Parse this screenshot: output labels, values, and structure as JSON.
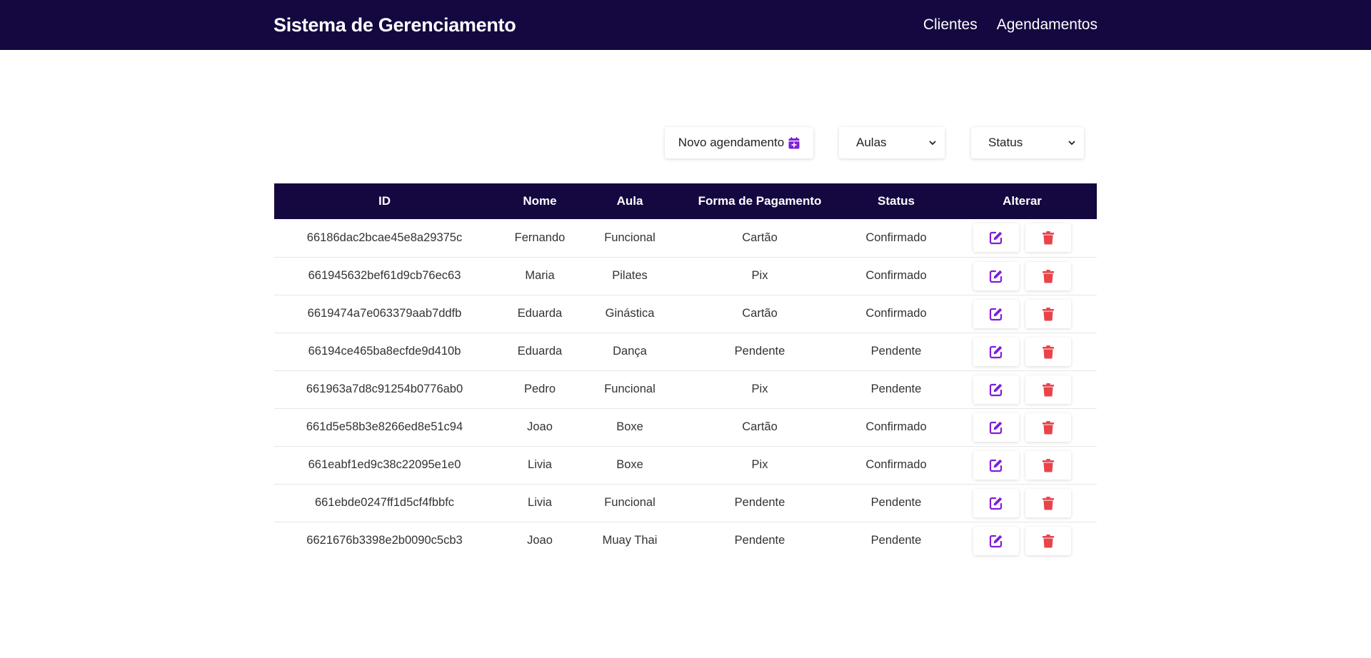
{
  "header": {
    "title": "Sistema de Gerenciamento",
    "nav": [
      "Clientes",
      "Agendamentos"
    ]
  },
  "toolbar": {
    "new_button_label": "Novo agendamento",
    "new_button_icon": "calendar-plus-icon",
    "aulas_select_value": "Aulas",
    "status_select_value": "Status"
  },
  "table": {
    "columns": [
      "ID",
      "Nome",
      "Aula",
      "Forma de Pagamento",
      "Status",
      "Alterar"
    ],
    "rows": [
      [
        "66186dac2bcae45e8a29375c",
        "Fernando",
        "Funcional",
        "Cartão",
        "Confirmado"
      ],
      [
        "661945632bef61d9cb76ec63",
        "Maria",
        "Pilates",
        "Pix",
        "Confirmado"
      ],
      [
        "6619474a7e063379aab7ddfb",
        "Eduarda",
        "Ginástica",
        "Cartão",
        "Confirmado"
      ],
      [
        "66194ce465ba8ecfde9d410b",
        "Eduarda",
        "Dança",
        "Pendente",
        "Pendente"
      ],
      [
        "661963a7d8c91254b0776ab0",
        "Pedro",
        "Funcional",
        "Pix",
        "Pendente"
      ],
      [
        "661d5e58b3e8266ed8e51c94",
        "Joao",
        "Boxe",
        "Cartão",
        "Confirmado"
      ],
      [
        "661eabf1ed9c38c22095e1e0",
        "Livia",
        "Boxe",
        "Pix",
        "Confirmado"
      ],
      [
        "661ebde0247ff1d5cf4fbbfc",
        "Livia",
        "Funcional",
        "Pendente",
        "Pendente"
      ],
      [
        "6621676b3398e2b0090c5cb3",
        "Joao",
        "Muay Thai",
        "Pendente",
        "Pendente"
      ]
    ],
    "edit_icon": "edit-icon",
    "delete_icon": "trash-icon"
  },
  "colors": {
    "navbar": "#150740",
    "accent_purple": "#7e1fd8",
    "delete_red": "#e8444a"
  }
}
